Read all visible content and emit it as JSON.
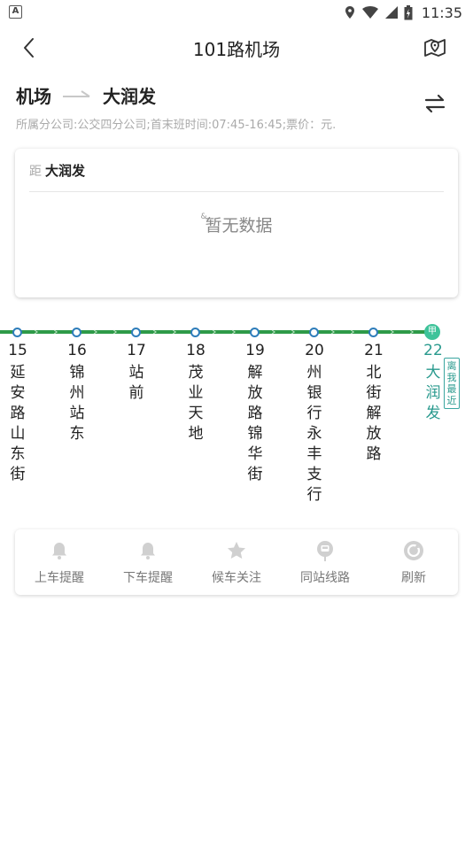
{
  "status_bar": {
    "time": "11:35",
    "app_badge": "A"
  },
  "header": {
    "title": "101路机场"
  },
  "route": {
    "from": "机场",
    "to": "大润发",
    "info": "所属分公司:公交四分公司;首末班时间:07:45-16:45;票价：元."
  },
  "distance_card": {
    "prefix": "距",
    "station": "大润发",
    "empty_text": "暂无数据",
    "empty_icon_text": "&"
  },
  "line": {
    "stops": [
      {
        "num": "15",
        "name": "延安路山东街"
      },
      {
        "num": "16",
        "name": "锦州站东"
      },
      {
        "num": "17",
        "name": "站前"
      },
      {
        "num": "18",
        "name": "茂业天地"
      },
      {
        "num": "19",
        "name": "解放路锦华街"
      },
      {
        "num": "20",
        "name": "州银行永丰支行"
      },
      {
        "num": "21",
        "name": "北街解放路"
      },
      {
        "num": "22",
        "name": "大润发"
      }
    ],
    "current_badge": "甲",
    "nearest_tag": "离我最近",
    "colors": {
      "track": "#2e9a48",
      "stop_ring": "#2e7dba",
      "current": "#2a9a8e"
    }
  },
  "actions": [
    {
      "label": "上车提醒",
      "icon": "bell-icon"
    },
    {
      "label": "下车提醒",
      "icon": "bell-icon"
    },
    {
      "label": "候车关注",
      "icon": "star-icon"
    },
    {
      "label": "同站线路",
      "icon": "bus-stop-icon"
    },
    {
      "label": "刷新",
      "icon": "refresh-icon"
    }
  ]
}
